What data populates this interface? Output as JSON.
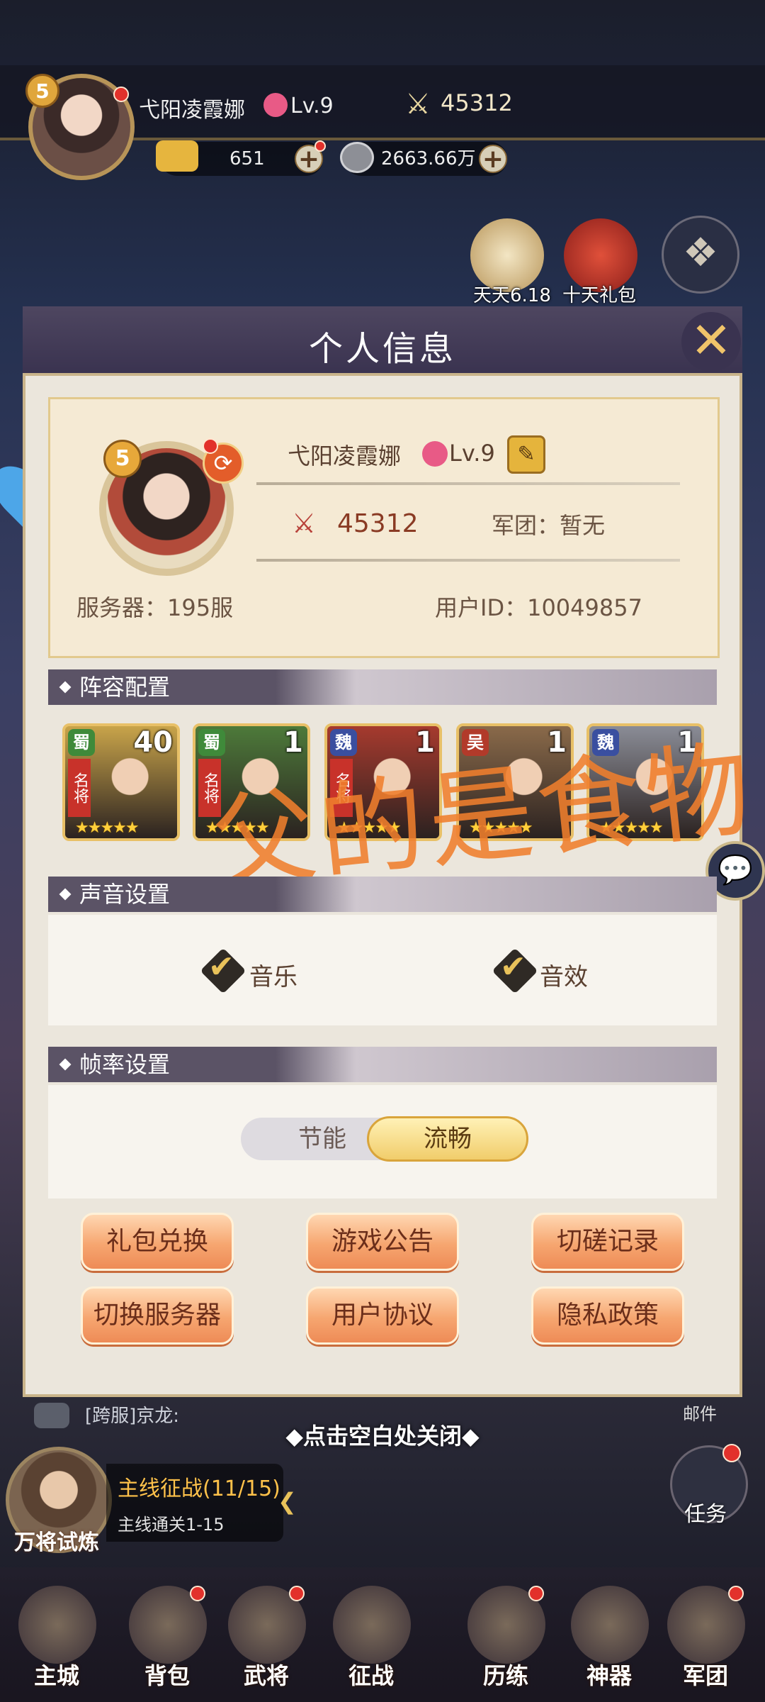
{
  "hud": {
    "vip_level": "5",
    "name": "弋阳凌霞娜",
    "level": "Lv.9",
    "power": "45312",
    "gold": "651",
    "coins": "2663.66万",
    "event_icons": [
      {
        "label": "天天6.18"
      },
      {
        "label": "十天礼包"
      }
    ]
  },
  "modal": {
    "title": "个人信息",
    "close_icon": "close-icon",
    "profile": {
      "vip_level": "5",
      "name": "弋阳凌霞娜",
      "level": "Lv.9",
      "power": "45312",
      "guild": "军团：暂无",
      "server": "服务器：195服",
      "user_id": "用户ID：10049857"
    },
    "lineup": {
      "title": "阵容配置",
      "heroes": [
        {
          "faction": "蜀",
          "count": "40",
          "tag": "名将",
          "stars": "★★★★★",
          "color": "#c9a44a"
        },
        {
          "faction": "蜀",
          "count": "1",
          "tag": "名将",
          "stars": "★★★★★",
          "color": "#4d7a3a"
        },
        {
          "faction": "魏",
          "count": "1",
          "tag": "名将",
          "stars": "★★★★★",
          "color": "#a63a2e"
        },
        {
          "faction": "吴",
          "count": "1",
          "tag": "",
          "stars": "★★★★★",
          "color": "#8a6a4a"
        },
        {
          "faction": "魏",
          "count": "1",
          "tag": "",
          "stars": "★★★★★",
          "color": "#8a8c96"
        }
      ]
    },
    "overlay_text": "父的是食物",
    "sound": {
      "title": "声音设置",
      "music_label": "音乐",
      "sfx_label": "音效"
    },
    "framerate": {
      "title": "帧率设置",
      "option_left": "节能",
      "option_right": "流畅",
      "selected": "流畅"
    },
    "buttons": {
      "gift_code": "礼包兑换",
      "announcement": "游戏公告",
      "duel_record": "切磋记录",
      "switch_server": "切换服务器",
      "user_agreement": "用户协议",
      "privacy_policy": "隐私政策"
    }
  },
  "bottom": {
    "close_hint": "◆点击空白处关闭◆",
    "chat": "[跨服]京龙:",
    "mail": "邮件",
    "quest_title": "主线征战(11/15)",
    "quest_sub": "主线通关1-15",
    "quest_under": "万将试炼",
    "task": "任务",
    "nav": [
      "主城",
      "背包",
      "武将",
      "征战",
      "历练",
      "神器",
      "军团"
    ]
  },
  "colors": {
    "accent": "#f0c46a",
    "button_orange": "#f6a670",
    "overlay_orange": "#f07f2d"
  }
}
